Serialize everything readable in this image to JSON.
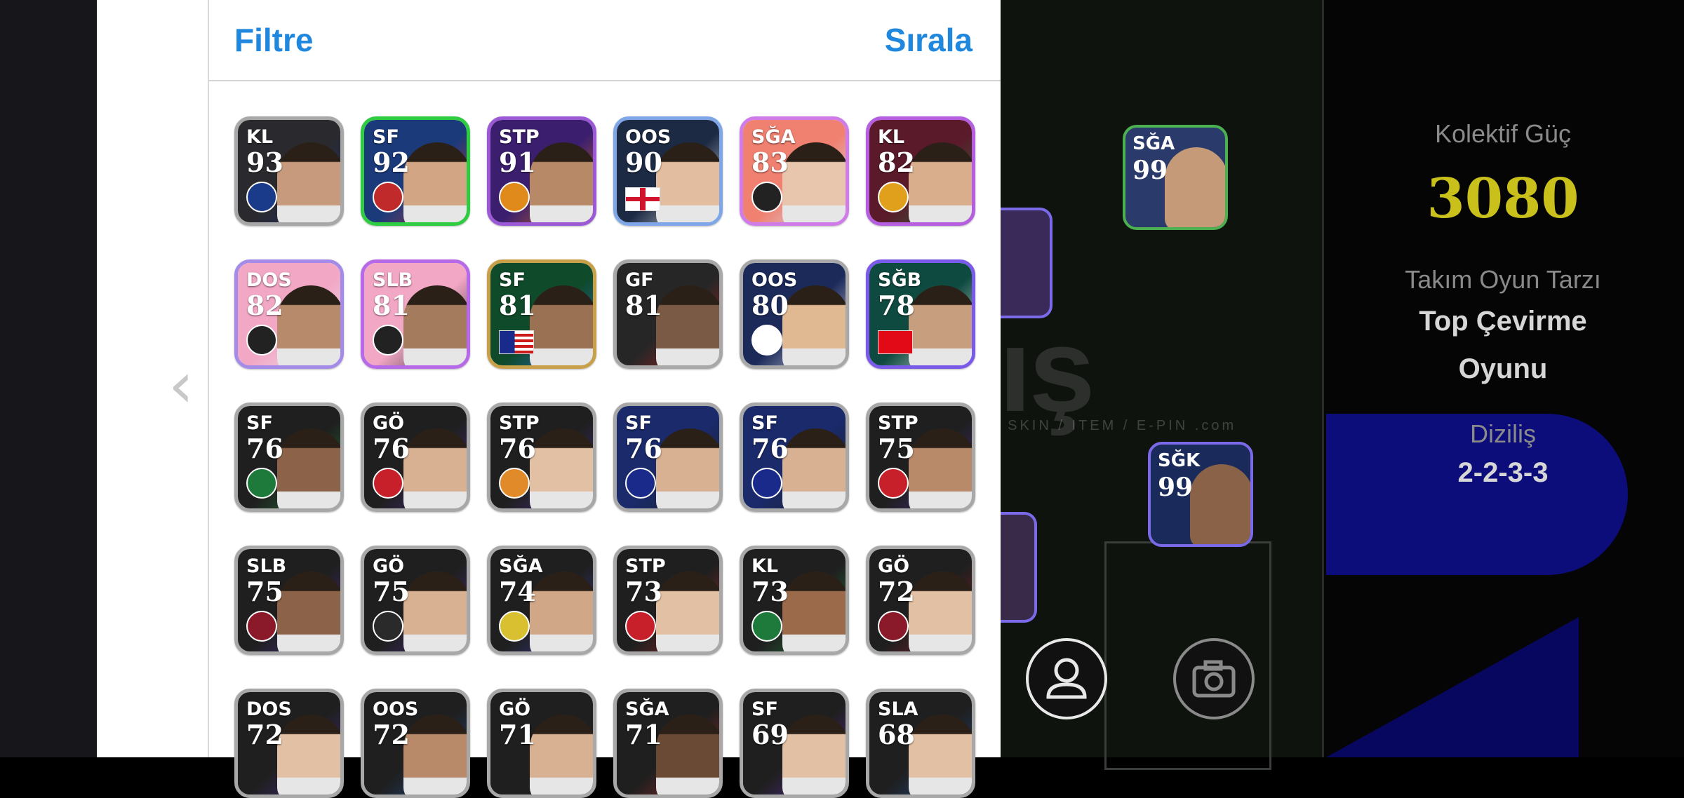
{
  "header": {
    "filter_label": "Filtre",
    "sort_label": "Sırala"
  },
  "cards": [
    {
      "pos": "KL",
      "ovr": "93",
      "bg": "#2a2a2e",
      "accent": "#1b2a6b",
      "border": "#a8a8a8",
      "face": "#c79a7d",
      "mark": "badge",
      "mark_color": "#1a3b8a"
    },
    {
      "pos": "SF",
      "ovr": "92",
      "bg": "#1a3a7a",
      "accent": "#c2353a",
      "border": "#2ecc40",
      "face": "#d2a684",
      "mark": "badge",
      "mark_color": "#c02a2a"
    },
    {
      "pos": "STP",
      "ovr": "91",
      "bg": "#3b1f6e",
      "accent": "#e06a1b",
      "border": "#9b59d6",
      "face": "#b88966",
      "mark": "badge",
      "mark_color": "#e08a1b"
    },
    {
      "pos": "OOS",
      "ovr": "90",
      "bg": "#1c2a44",
      "accent": "#e8e8e8",
      "border": "#7fa7e8",
      "face": "#e3bda0",
      "mark": "flag-eng",
      "mark_color": "#ffffff"
    },
    {
      "pos": "SĞA",
      "ovr": "83",
      "bg": "#f08070",
      "accent": "#cfe6f5",
      "border": "#cf7be8",
      "face": "#e7c6ad",
      "mark": "badge",
      "mark_color": "#222222"
    },
    {
      "pos": "KL",
      "ovr": "82",
      "bg": "#5a1a2a",
      "accent": "#2a6b3a",
      "border": "#b65ee0",
      "face": "#d8ae8c",
      "mark": "badge",
      "mark_color": "#e0a01b"
    },
    {
      "pos": "DOS",
      "ovr": "82",
      "bg": "#f2a7c5",
      "accent": "#e7e7ee",
      "border": "#a58be8",
      "face": "#b88a6c",
      "mark": "badge",
      "mark_color": "#222222"
    },
    {
      "pos": "SLB",
      "ovr": "81",
      "bg": "#f2a7c5",
      "accent": "#2a2a2a",
      "border": "#b76ae8",
      "face": "#a57b5e",
      "mark": "badge",
      "mark_color": "#222222"
    },
    {
      "pos": "SF",
      "ovr": "81",
      "bg": "#0f4a2a",
      "accent": "#2a6ad0",
      "border": "#c8a04a",
      "face": "#9a7152",
      "mark": "flag-my",
      "mark_color": "#1a2a8a"
    },
    {
      "pos": "GF",
      "ovr": "81",
      "bg": "#262626",
      "accent": "#b22222",
      "border": "#a8a8a8",
      "face": "#7a5a44",
      "mark": "none",
      "mark_color": "#222222"
    },
    {
      "pos": "OOS",
      "ovr": "80",
      "bg": "#1c2a5a",
      "accent": "#dfe4ea",
      "border": "#a8a8a8",
      "face": "#e0b892",
      "mark": "badge",
      "mark_color": "#ffffff"
    },
    {
      "pos": "SĞB",
      "ovr": "78",
      "bg": "#0f4a40",
      "accent": "#e8e8e8",
      "border": "#7a5ae8",
      "face": "#c89f7e",
      "mark": "flag-tr",
      "mark_color": "#e30a17"
    },
    {
      "pos": "SF",
      "ovr": "76",
      "bg": "#1f1f1f",
      "accent": "#1e7a3a",
      "border": "#a8a8a8",
      "face": "#8c6248",
      "mark": "badge",
      "mark_color": "#1e7a3a"
    },
    {
      "pos": "GÖ",
      "ovr": "76",
      "bg": "#1f1f1f",
      "accent": "#4a2a8a",
      "border": "#a8a8a8",
      "face": "#d8b092",
      "mark": "badge",
      "mark_color": "#c8202a"
    },
    {
      "pos": "STP",
      "ovr": "76",
      "bg": "#1f1f1f",
      "accent": "#4a2a8a",
      "border": "#a8a8a8",
      "face": "#e2c0a4",
      "mark": "badge",
      "mark_color": "#e08a2a"
    },
    {
      "pos": "SF",
      "ovr": "76",
      "bg": "#1a2a6a",
      "accent": "#1f1f1f",
      "border": "#a8a8a8",
      "face": "#d8b092",
      "mark": "badge",
      "mark_color": "#1a2a8a"
    },
    {
      "pos": "SF",
      "ovr": "76",
      "bg": "#1a2a6a",
      "accent": "#1f1f1f",
      "border": "#a8a8a8",
      "face": "#d8b092",
      "mark": "badge",
      "mark_color": "#1a2a8a"
    },
    {
      "pos": "STP",
      "ovr": "75",
      "bg": "#1f1f1f",
      "accent": "#4a2a8a",
      "border": "#a8a8a8",
      "face": "#b88a6a",
      "mark": "badge",
      "mark_color": "#c8202a"
    },
    {
      "pos": "SLB",
      "ovr": "75",
      "bg": "#1f1f1f",
      "accent": "#4a2a8a",
      "border": "#a8a8a8",
      "face": "#8c6248",
      "mark": "badge",
      "mark_color": "#8a1a2a"
    },
    {
      "pos": "GÖ",
      "ovr": "75",
      "bg": "#1f1f1f",
      "accent": "#4a2a8a",
      "border": "#a8a8a8",
      "face": "#d8b092",
      "mark": "badge",
      "mark_color": "#2a2a2a"
    },
    {
      "pos": "SĞA",
      "ovr": "74",
      "bg": "#1f1f1f",
      "accent": "#3a3aa0",
      "border": "#a8a8a8",
      "face": "#d0a888",
      "mark": "badge",
      "mark_color": "#d8c030"
    },
    {
      "pos": "STP",
      "ovr": "73",
      "bg": "#1f1f1f",
      "accent": "#a02a2a",
      "border": "#a8a8a8",
      "face": "#e2c0a4",
      "mark": "badge",
      "mark_color": "#c8202a"
    },
    {
      "pos": "KL",
      "ovr": "73",
      "bg": "#1f1f1f",
      "accent": "#1e7a3a",
      "border": "#a8a8a8",
      "face": "#9a6a4a",
      "mark": "badge",
      "mark_color": "#1e7a3a"
    },
    {
      "pos": "GÖ",
      "ovr": "72",
      "bg": "#1f1f1f",
      "accent": "#8a1a2a",
      "border": "#a8a8a8",
      "face": "#e2c0a4",
      "mark": "badge",
      "mark_color": "#8a1a2a"
    },
    {
      "pos": "DOS",
      "ovr": "72",
      "bg": "#1f1f1f",
      "accent": "#4a2a8a",
      "border": "#a8a8a8",
      "face": "#e2c0a4",
      "mark": "none",
      "mark_color": "#222222"
    },
    {
      "pos": "OOS",
      "ovr": "72",
      "bg": "#1f1f1f",
      "accent": "#1e4a8a",
      "border": "#a8a8a8",
      "face": "#b88a6a",
      "mark": "none",
      "mark_color": "#222222"
    },
    {
      "pos": "GÖ",
      "ovr": "71",
      "bg": "#1f1f1f",
      "accent": "#1f1f1f",
      "border": "#a8a8a8",
      "face": "#d8b092",
      "mark": "none",
      "mark_color": "#222222"
    },
    {
      "pos": "SĞA",
      "ovr": "71",
      "bg": "#1f1f1f",
      "accent": "#a02a2a",
      "border": "#a8a8a8",
      "face": "#6a4a34",
      "mark": "none",
      "mark_color": "#222222"
    },
    {
      "pos": "SF",
      "ovr": "69",
      "bg": "#1f1f1f",
      "accent": "#5a2aa0",
      "border": "#a8a8a8",
      "face": "#e2c0a4",
      "mark": "none",
      "mark_color": "#222222"
    },
    {
      "pos": "SLA",
      "ovr": "68",
      "bg": "#1f1f1f",
      "accent": "#1e4a8a",
      "border": "#a8a8a8",
      "face": "#e2c0a4",
      "mark": "none",
      "mark_color": "#222222"
    }
  ],
  "field_cards": [
    {
      "pos": "SĞA",
      "ovr": "99",
      "border": "#4caf50",
      "bg": "#2a3a6a"
    },
    {
      "pos": "SĞK",
      "ovr": "99",
      "border": "#7a6ae8",
      "bg": "#1a2a5a"
    }
  ],
  "stats": {
    "power_label": "Kolektif Güç",
    "power_value": "3080",
    "style_label": "Takım Oyun Tarzı",
    "style_value_1": "Top Çevirme",
    "style_value_2": "Oyunu",
    "formation_label": "Diziliş",
    "formation_value": "2-2-3-3"
  },
  "watermark": {
    "text": "atış",
    "sub": "HESAP / SKIN / ITEM / E-PIN .com"
  },
  "colors": {
    "accent_blue": "#1f87de",
    "power_yellow": "#c9c01b"
  }
}
